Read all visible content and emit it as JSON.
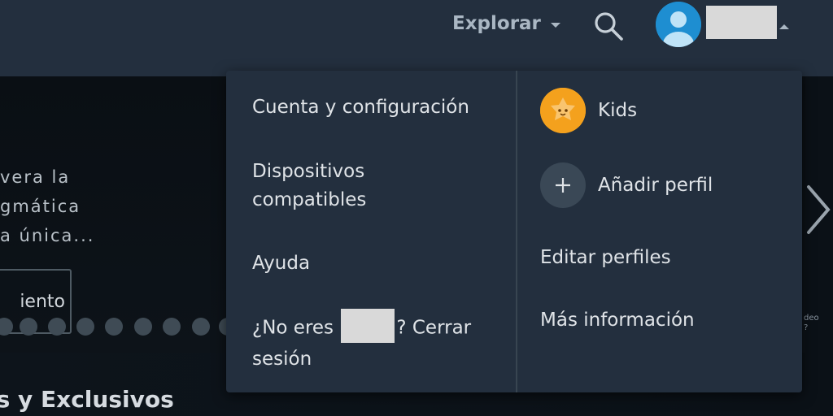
{
  "header": {
    "explore_label": "Explorar"
  },
  "hero": {
    "lines": [
      "vera   la",
      "gmática",
      "a  única..."
    ],
    "detail_button": "iento"
  },
  "side_text": "deo\n?",
  "row_title": "ls y Exclusivos",
  "menu": {
    "account": "Cuenta y configuración",
    "devices_line1": "Dispositivos",
    "devices_line2": "compatibles",
    "help": "Ayuda",
    "signout_prefix": "¿No eres",
    "signout_suffix": "? Cerrar",
    "signout_line2": "sesión"
  },
  "profiles": {
    "kids": "Kids",
    "add_profile": "Añadir perfil",
    "edit_profiles": "Editar perfiles",
    "more_info": "Más información"
  },
  "colors": {
    "header_bg": "#232f3e",
    "avatar_blue": "#1e8ed1",
    "kids_orange": "#f4a11d"
  }
}
